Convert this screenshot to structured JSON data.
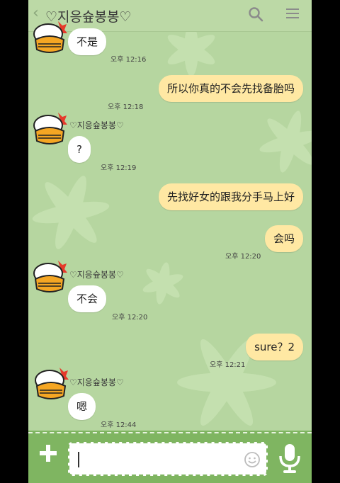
{
  "header": {
    "back_glyph": "‹",
    "title": "♡지응슢봉봉♡",
    "search_icon": "search-icon",
    "menu_icon": "menu-icon"
  },
  "messages": [
    {
      "side": "in",
      "text": "不是",
      "time": "오후 12:16"
    },
    {
      "side": "out",
      "text": "所以你真的不会先找备胎吗",
      "time": "오후 12:18"
    },
    {
      "side": "in",
      "name": "♡지응슢봉봉♡",
      "text": "?",
      "time": "오후 12:19"
    },
    {
      "side": "out",
      "text": "先找好女的跟我分手马上好",
      "time": ""
    },
    {
      "side": "out",
      "text": "会吗",
      "time": "오후 12:20"
    },
    {
      "side": "in",
      "name": "♡지응슢봉봉♡",
      "text": "不会",
      "time": "오후 12:20"
    },
    {
      "side": "out",
      "text": "sure？2",
      "time": "오후 12:21"
    },
    {
      "side": "in",
      "name": "♡지응슢봉봉♡",
      "text": "嗯",
      "time": "오후 12:44"
    }
  ],
  "composer": {
    "plus_icon": "plus-icon",
    "emoji_icon": "smile-icon",
    "mic_icon": "microphone-icon",
    "input_value": ""
  },
  "colors": {
    "background": "#b6d6a0",
    "incoming_bubble": "#ffffff",
    "outgoing_bubble": "#ffe8a3",
    "footer": "#7fb561"
  }
}
